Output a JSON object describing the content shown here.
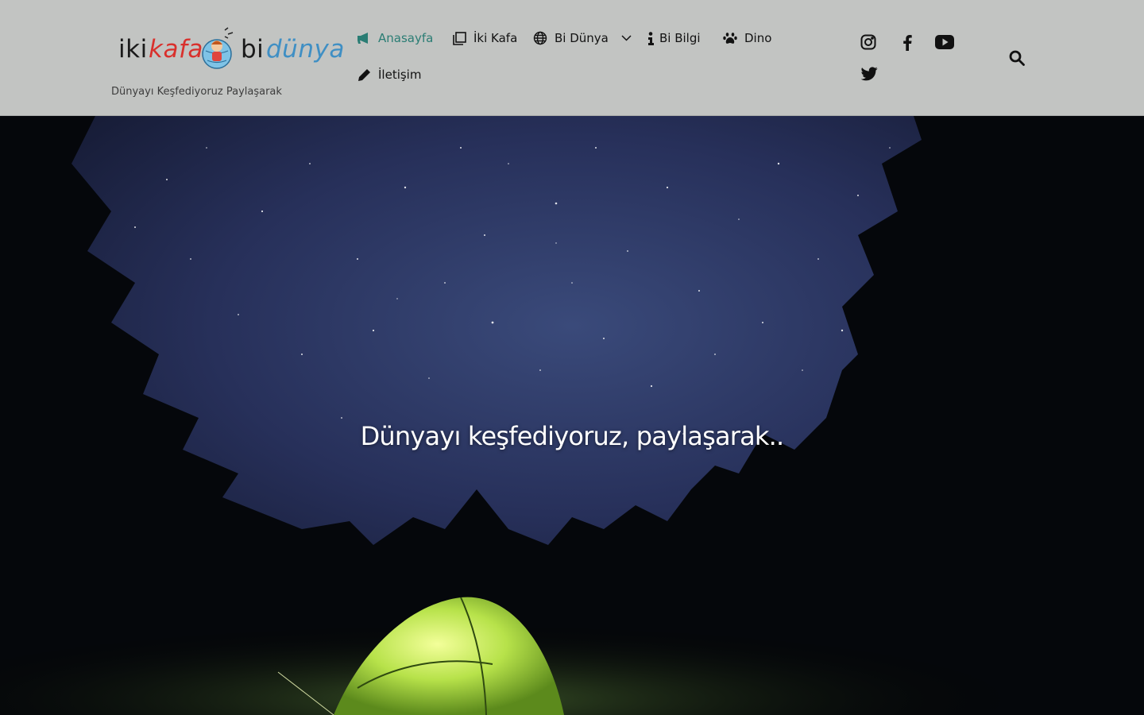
{
  "site": {
    "logo": {
      "word1": "iki",
      "word2": "kafa",
      "word3": "bi",
      "word4": "dünya"
    },
    "tagline": "Dünyayı Keşfediyoruz Paylaşarak"
  },
  "nav": {
    "items": [
      {
        "label": "Anasayfa",
        "icon": "megaphone-icon",
        "active": true
      },
      {
        "label": "İki Kafa",
        "icon": "copy-icon"
      },
      {
        "label": "Bi Dünya",
        "icon": "globe-icon",
        "has_dropdown": true
      },
      {
        "label": "Bi Bilgi",
        "icon": "info-icon"
      },
      {
        "label": "Dino",
        "icon": "paw-icon"
      },
      {
        "label": "İletişim",
        "icon": "pencil-icon"
      }
    ]
  },
  "social": [
    "instagram-icon",
    "facebook-icon",
    "youtube-icon",
    "twitter-icon"
  ],
  "hero": {
    "title": "Dünyayı keşfediyoruz, paylaşarak.."
  },
  "colors": {
    "header_bg": "#c2c4c2",
    "accent": "#2a7d74",
    "kafa": "#d9302c",
    "dunya": "#3f8fc4"
  }
}
